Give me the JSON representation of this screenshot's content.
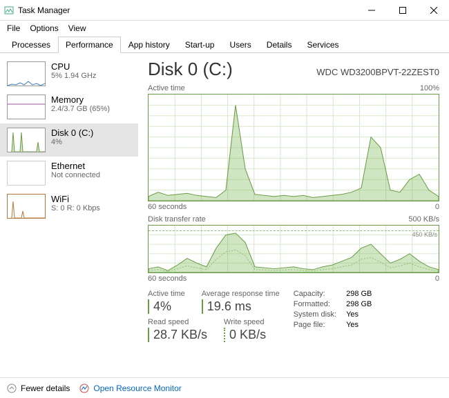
{
  "window": {
    "title": "Task Manager"
  },
  "menu": {
    "file": "File",
    "options": "Options",
    "view": "View"
  },
  "tabs": {
    "processes": "Processes",
    "performance": "Performance",
    "apphistory": "App history",
    "startup": "Start-up",
    "users": "Users",
    "details": "Details",
    "services": "Services"
  },
  "sidebar": {
    "cpu": {
      "title": "CPU",
      "sub": "5% 1.94 GHz",
      "color": "#3a78c4"
    },
    "memory": {
      "title": "Memory",
      "sub": "2.4/3.7 GB (65%)",
      "color": "#9c4f9c"
    },
    "disk": {
      "title": "Disk 0 (C:)",
      "sub": "4%",
      "color": "#6a9c47"
    },
    "ethernet": {
      "title": "Ethernet",
      "sub": "Not connected",
      "color": "#bbb"
    },
    "wifi": {
      "title": "WiFi",
      "sub": "S: 0 R: 0 Kbps",
      "color": "#b07838"
    }
  },
  "main": {
    "title": "Disk 0 (C:)",
    "model": "WDC WD3200BPVT-22ZEST0",
    "chart1": {
      "label": "Active time",
      "max": "100%",
      "xleft": "60 seconds",
      "xright": "0"
    },
    "chart2": {
      "label": "Disk transfer rate",
      "max": "500 KB/s",
      "mark": "450 KB/s",
      "xleft": "60 seconds",
      "xright": "0"
    },
    "stats": {
      "active_time": {
        "label": "Active time",
        "value": "4%"
      },
      "avg_response": {
        "label": "Average response time",
        "value": "19.6 ms"
      },
      "read_speed": {
        "label": "Read speed",
        "value": "28.7 KB/s"
      },
      "write_speed": {
        "label": "Write speed",
        "value": "0 KB/s"
      }
    },
    "info": {
      "capacity_l": "Capacity:",
      "capacity_v": "298 GB",
      "formatted_l": "Formatted:",
      "formatted_v": "298 GB",
      "sysdisk_l": "System disk:",
      "sysdisk_v": "Yes",
      "pagefile_l": "Page file:",
      "pagefile_v": "Yes"
    }
  },
  "footer": {
    "fewer": "Fewer details",
    "orm": "Open Resource Monitor"
  },
  "chart_data": [
    {
      "type": "area",
      "title": "Active time",
      "ylabel": "%",
      "ylim": [
        0,
        100
      ],
      "x_seconds_ago": [
        60,
        58,
        56,
        54,
        52,
        50,
        48,
        46,
        44,
        42,
        40,
        38,
        36,
        34,
        32,
        30,
        28,
        26,
        24,
        22,
        20,
        18,
        16,
        14,
        12,
        10,
        8,
        6,
        4,
        2,
        0
      ],
      "values": [
        4,
        8,
        5,
        6,
        7,
        5,
        4,
        3,
        10,
        90,
        30,
        6,
        5,
        4,
        5,
        4,
        5,
        3,
        4,
        5,
        6,
        8,
        12,
        60,
        50,
        10,
        8,
        20,
        25,
        10,
        4
      ]
    },
    {
      "type": "area",
      "title": "Disk transfer rate",
      "ylabel": "KB/s",
      "ylim": [
        0,
        500
      ],
      "series": [
        {
          "name": "Read",
          "values": [
            40,
            60,
            20,
            80,
            150,
            100,
            60,
            260,
            400,
            420,
            320,
            60,
            50,
            40,
            50,
            60,
            40,
            30,
            60,
            80,
            120,
            160,
            260,
            300,
            200,
            100,
            140,
            200,
            120,
            60,
            30
          ]
        },
        {
          "name": "Write",
          "values": [
            20,
            30,
            10,
            40,
            70,
            50,
            30,
            140,
            220,
            240,
            180,
            30,
            25,
            20,
            25,
            30,
            20,
            15,
            30,
            40,
            60,
            80,
            140,
            160,
            110,
            50,
            70,
            100,
            60,
            30,
            15
          ]
        }
      ],
      "x_seconds_ago": [
        60,
        58,
        56,
        54,
        52,
        50,
        48,
        46,
        44,
        42,
        40,
        38,
        36,
        34,
        32,
        30,
        28,
        26,
        24,
        22,
        20,
        18,
        16,
        14,
        12,
        10,
        8,
        6,
        4,
        2,
        0
      ]
    }
  ]
}
